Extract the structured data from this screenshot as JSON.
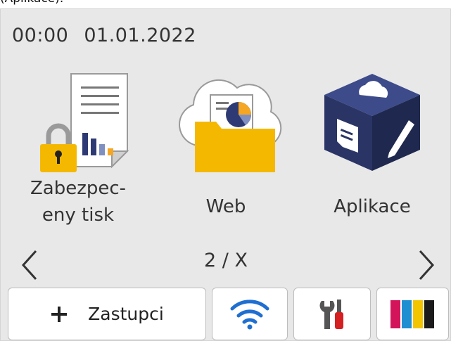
{
  "caption": "(Aplikace).",
  "status": {
    "time": "00:00",
    "date": "01.01.2022"
  },
  "tiles": [
    {
      "label_line1": "Zabezpec-",
      "label_line2": "eny tisk",
      "icon": "secure-print-icon"
    },
    {
      "label": "Web",
      "icon": "web-folder-icon"
    },
    {
      "label": "Aplikace",
      "icon": "apps-cube-icon"
    }
  ],
  "pager": {
    "text": "2 / X"
  },
  "bottom_bar": {
    "shortcuts_label": "Zastupci",
    "icons": [
      "plus-icon",
      "wifi-icon",
      "tools-icon",
      "ink-icon"
    ]
  },
  "colors": {
    "screen": "#e8e8e8",
    "folder": "#f5b800",
    "cube": "#2e3a73",
    "ink_magenta": "#d4145a",
    "ink_cyan": "#1f8fd1",
    "ink_yellow": "#f2c500",
    "ink_black": "#1b1b1b"
  }
}
